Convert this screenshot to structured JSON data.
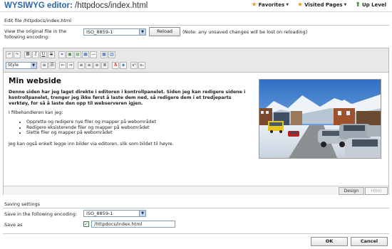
{
  "header": {
    "title": "WYSIWYG editor:",
    "path": "/httpdocs/index.html",
    "links": [
      {
        "label": "Favorites",
        "icon": "star-icon"
      },
      {
        "label": "Visited Pages",
        "icon": "star-icon"
      },
      {
        "label": "Up Level",
        "icon": "up-arrow-icon"
      }
    ]
  },
  "edit_file": {
    "label": "Edit file /httpdocs/index.html",
    "encoding_label": "View the original file in the following encoding:",
    "encoding_value": "ISO_8859-1",
    "reload_label": "Reload",
    "reload_note": "(Note: any unsaved changes will be lost on reloading)"
  },
  "toolbar": {
    "style_value": "Style"
  },
  "document": {
    "heading": "Min webside",
    "intro": "Denne siden har jeg laget direkte i editoren i kontrollpanelet. Siden jeg kan redigere sidene i kontrollpanelet, trenger jeg ikke først å laste dem ned, så redigere dem i et tredjeparts verktøy, for så å laste den opp til webserveren igjen.",
    "file_manager_text": "I filbehandleren kan jeg:",
    "bullets": [
      "Opprette og redigere nye filer og mapper på webområdet",
      "Redigere eksisterende filer og mapper på webområdet",
      "Slette filer og mapper på webområdet"
    ],
    "outro": "Jeg kan også enkelt legge inn bilder via editoren, slik som bildet til høyre."
  },
  "tabs": {
    "design": "Design",
    "html": "Html"
  },
  "saving": {
    "section_label": "Saving settings",
    "encoding_label": "Save in the following encoding:",
    "encoding_value": "ISO_8859-1",
    "save_as_label": "Save as",
    "save_as_value": "/httpdocs/index.html"
  },
  "footer": {
    "ok_label": "OK",
    "cancel_label": "Cancel"
  },
  "colors": {
    "title": "#2a67a9",
    "favorite_star": "#e2a21a",
    "checkbox": "#1a6b1a"
  }
}
